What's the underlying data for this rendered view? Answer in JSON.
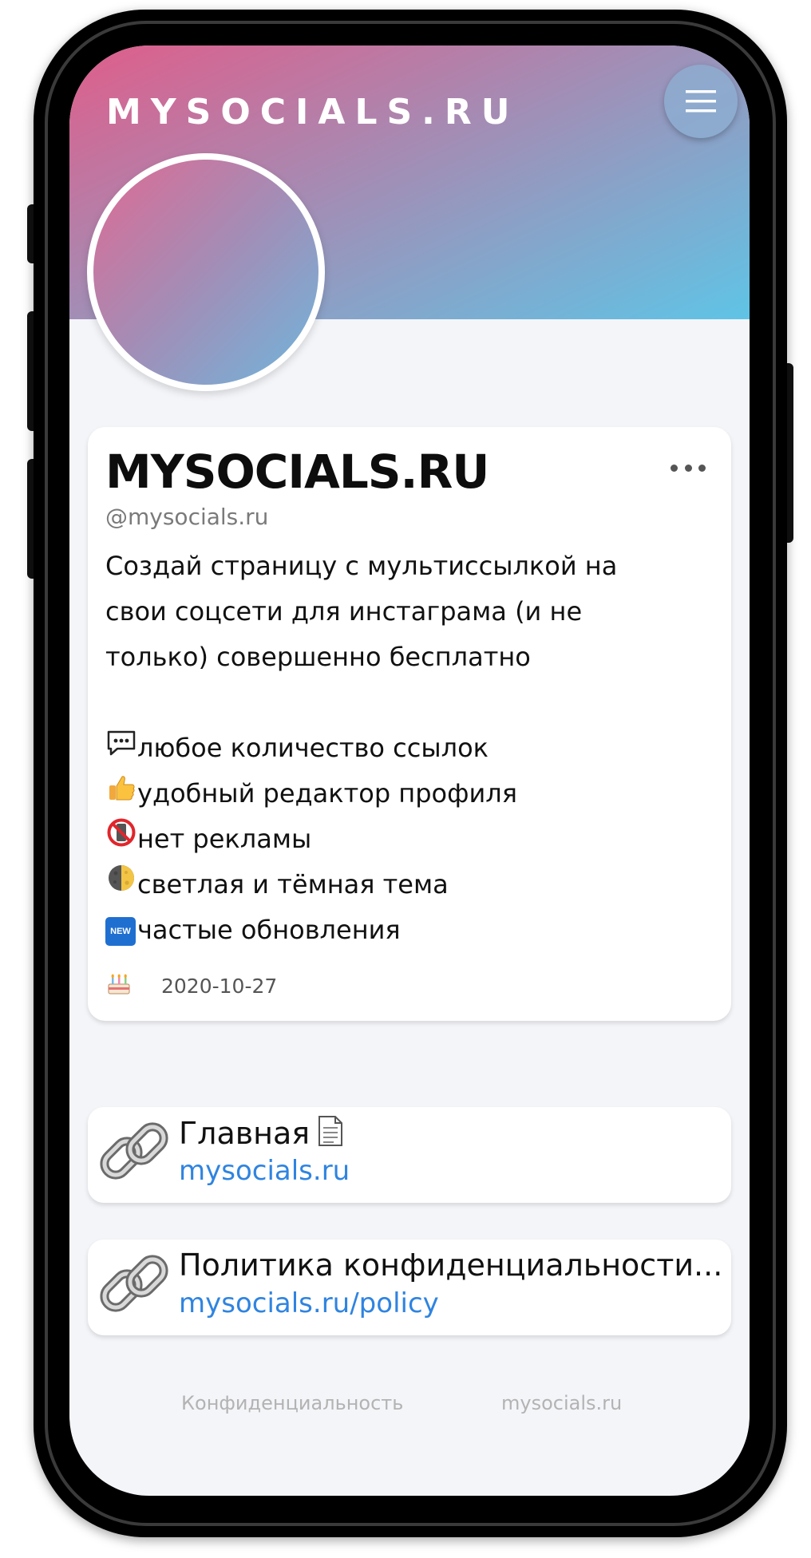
{
  "header": {
    "brand": "MYSOCIALS.RU",
    "menu_icon": "hamburger-icon"
  },
  "profile": {
    "name": "MYSOCIALS.RU",
    "handle": "@mysocials.ru",
    "more_icon": "more-dots-icon",
    "bio_lines": [
      "Создай страницу с мультиссылкой на",
      "свои соцсети для инстаграма (и не",
      "только) совершенно бесплатно"
    ],
    "features": [
      {
        "icon": "speech-bubble-icon",
        "text": "любое количество ссылок"
      },
      {
        "icon": "thumbs-up-icon",
        "text": "удобный редактор профиля"
      },
      {
        "icon": "no-phones-icon",
        "text": "нет рекламы"
      },
      {
        "icon": "half-moon-icon",
        "text": "светлая и тёмная тема"
      },
      {
        "icon": "new-badge-icon",
        "text": "частые обновления",
        "badge": "NEW"
      }
    ],
    "birthday_icon": "cake-icon",
    "created": "2020-10-27"
  },
  "links": [
    {
      "title": "Главная",
      "url": "mysocials.ru",
      "icon": "chain-link-icon",
      "suffix_icon": "document-icon"
    },
    {
      "title": "Политика конфиденциальности...",
      "url": "mysocials.ru/policy",
      "icon": "chain-link-icon"
    }
  ],
  "footer": {
    "privacy": "Конфиденциальность",
    "site": "mysocials.ru"
  }
}
